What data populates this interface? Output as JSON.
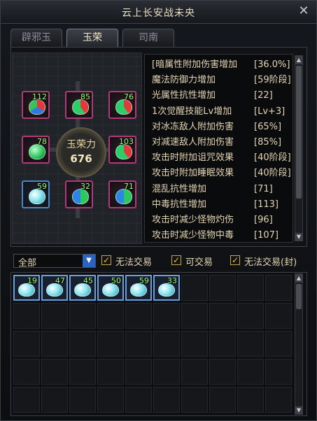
{
  "window": {
    "title": "云上长安战未央",
    "close_glyph": "✕"
  },
  "tabs": [
    {
      "label": "辟邪玉",
      "active": false
    },
    {
      "label": "玉荣",
      "active": true
    },
    {
      "label": "司南",
      "active": false
    }
  ],
  "center": {
    "label": "玉荣力",
    "value": "676"
  },
  "slots": [
    {
      "count": "112",
      "gem": "multi-gem-icon"
    },
    {
      "count": "85",
      "gem": "red-green-gem-icon"
    },
    {
      "count": "76",
      "gem": "red-green-gem-icon"
    },
    {
      "count": "78",
      "gem": "green-gem-icon"
    },
    {
      "count": "103",
      "gem": "red-green-gem-icon"
    },
    {
      "count": "59",
      "gem": "crystal-gem-icon"
    },
    {
      "count": "32",
      "gem": "green-blue-gem-icon"
    },
    {
      "count": "71",
      "gem": "green-blue-gem-icon"
    }
  ],
  "stats": [
    {
      "name": "[暗属性附加伤害增加",
      "value": "[36.0%]"
    },
    {
      "name": "魔法防御力增加",
      "value": "[59阶段]"
    },
    {
      "name": "光属性抗性增加",
      "value": "[22]"
    },
    {
      "name": "1次觉醒技能Lv增加",
      "value": "[Lv+3]"
    },
    {
      "name": "对冰冻敌人附加伤害",
      "value": "[65%]"
    },
    {
      "name": "对减速敌人附加伤害",
      "value": "[85%]"
    },
    {
      "name": "攻击时附加诅咒效果",
      "value": "[40阶段]"
    },
    {
      "name": "攻击时附加睡眠效果",
      "value": "[40阶段]"
    },
    {
      "name": "混乱抗性增加",
      "value": "[71]"
    },
    {
      "name": "中毒抗性增加",
      "value": "[113]"
    },
    {
      "name": "攻击时减少怪物灼伤",
      "value": "[96]"
    },
    {
      "name": "攻击时减少怪物中毒",
      "value": "[107]"
    }
  ],
  "filter": {
    "select_value": "全部",
    "options": [
      {
        "label": "无法交易",
        "checked": true
      },
      {
        "label": "可交易",
        "checked": true
      },
      {
        "label": "无法交易(封)",
        "checked": true
      }
    ],
    "check_glyph": "✓"
  },
  "inventory": {
    "items": [
      "19",
      "47",
      "45",
      "50",
      "59",
      "33"
    ]
  },
  "scroll": {
    "up": "▲",
    "down": "▼"
  }
}
